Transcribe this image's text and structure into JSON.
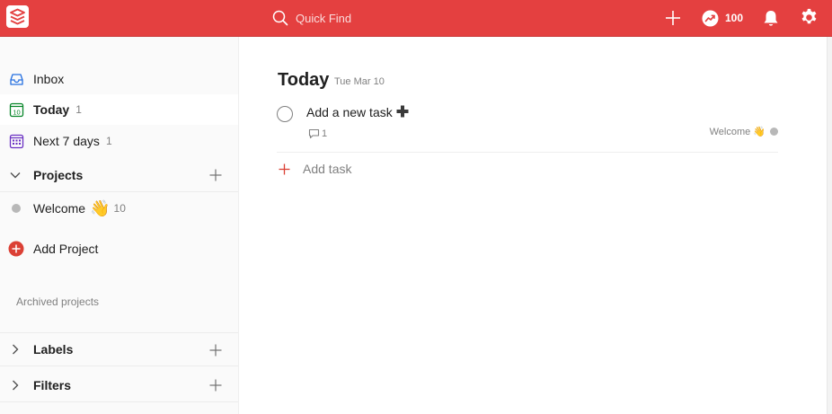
{
  "topbar": {
    "search_placeholder": "Quick Find",
    "karma": "100"
  },
  "sidebar": {
    "nav": [
      {
        "label": "Inbox",
        "count": ""
      },
      {
        "label": "Today",
        "count": "1"
      },
      {
        "label": "Next 7 days",
        "count": "1"
      }
    ],
    "today_icon_text": "10",
    "projects_label": "Projects",
    "project": {
      "name": "Welcome",
      "emoji": "👋",
      "count": "10"
    },
    "add_project": "Add Project",
    "archived": "Archived projects",
    "labels": "Labels",
    "filters": "Filters"
  },
  "main": {
    "title": "Today",
    "date": "Tue Mar 10",
    "task": {
      "text": "Add a new task",
      "comments": "1",
      "project": "Welcome 👋"
    },
    "add_task": "Add task"
  },
  "colors": {
    "topbar": "#e44040",
    "accent": "#db4035",
    "today_green": "#058527",
    "upcoming_purple": "#692fc2",
    "inbox_blue": "#246fe0"
  }
}
